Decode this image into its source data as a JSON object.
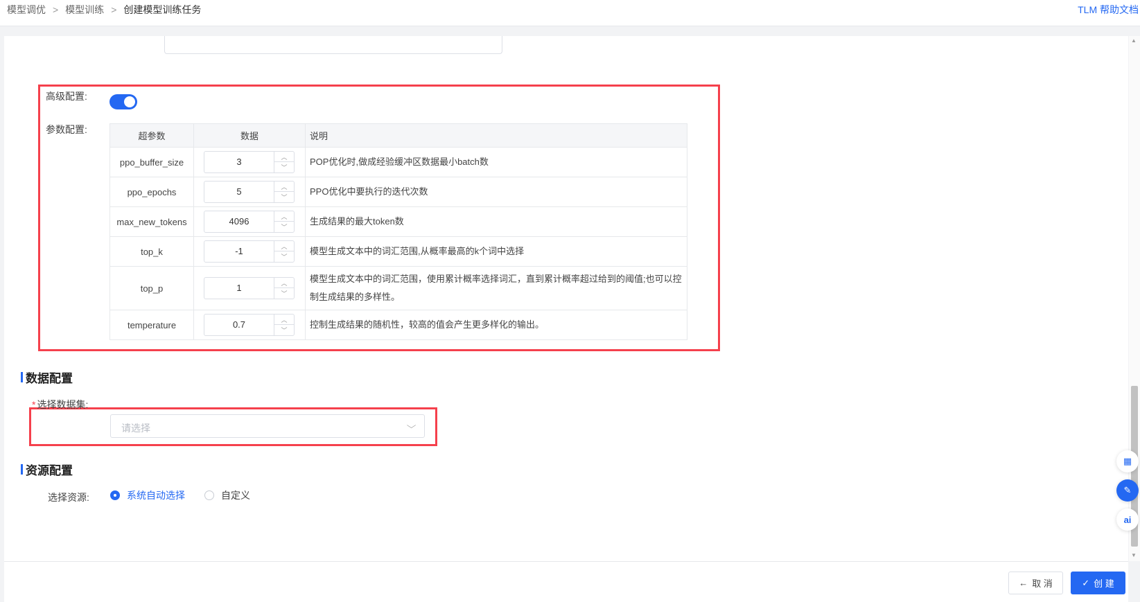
{
  "breadcrumb": {
    "items": [
      "模型调优",
      "模型训练",
      "创建模型训练任务"
    ]
  },
  "help": {
    "label": "TLM 帮助文档"
  },
  "advanced": {
    "label": "高级配置:",
    "enabled": true,
    "params_label": "参数配置:",
    "headers": [
      "超参数",
      "数据",
      "说明"
    ],
    "rows": [
      {
        "name": "ppo_buffer_size",
        "value": "3",
        "desc": "POP优化时,做成经验缓冲区数据最小batch数"
      },
      {
        "name": "ppo_epochs",
        "value": "5",
        "desc": "PPO优化中要执行的迭代次数"
      },
      {
        "name": "max_new_tokens",
        "value": "4096",
        "desc": "生成结果的最大token数"
      },
      {
        "name": "top_k",
        "value": "-1",
        "desc": "模型生成文本中的词汇范围,从概率最高的k个词中选择"
      },
      {
        "name": "top_p",
        "value": "1",
        "desc": "模型生成文本中的词汇范围，使用累计概率选择词汇，直到累计概率超过给到的阈值;也可以控制生成结果的多样性。"
      },
      {
        "name": "temperature",
        "value": "0.7",
        "desc": "控制生成结果的随机性，较高的值会产生更多样化的输出。"
      }
    ]
  },
  "data_config": {
    "title": "数据配置",
    "dataset_label": "选择数据集:",
    "required_mark": "*",
    "dataset_placeholder": "请选择"
  },
  "resource_config": {
    "title": "资源配置",
    "label": "选择资源:",
    "options": [
      {
        "label": "系统自动选择",
        "selected": true
      },
      {
        "label": "自定义",
        "selected": false
      }
    ]
  },
  "footer": {
    "cancel_label": "取 消",
    "create_label": "创 建"
  },
  "side_fabs": [
    "qr-code-icon",
    "edit-icon",
    "ai-icon"
  ],
  "colors": {
    "primary": "#2468f2",
    "highlight_border": "#f5404c"
  }
}
